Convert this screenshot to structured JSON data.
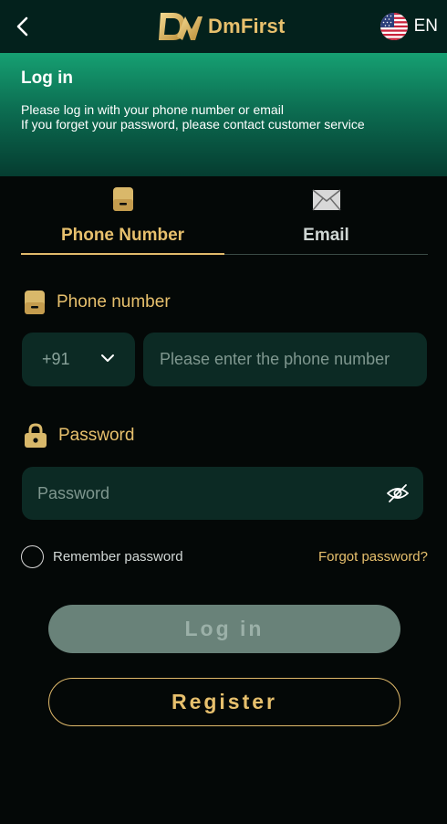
{
  "header": {
    "brand_name": "DmFirst",
    "language": "EN"
  },
  "banner": {
    "title": "Log in",
    "line1": "Please log in with your phone number or email",
    "line2": "If you forget your password, please contact customer service"
  },
  "tabs": [
    {
      "label": "Phone Number",
      "icon": "phone-icon",
      "active": true
    },
    {
      "label": "Email",
      "icon": "envelope-icon",
      "active": false
    }
  ],
  "phone_field": {
    "label": "Phone number",
    "country_code": "+91",
    "placeholder": "Please enter the phone number"
  },
  "password_field": {
    "label": "Password",
    "placeholder": "Password"
  },
  "remember": {
    "label": "Remember password"
  },
  "forgot": {
    "label": "Forgot password?"
  },
  "buttons": {
    "login": "Log in",
    "register": "Register"
  },
  "colors": {
    "gold": "#e7c06d",
    "background": "#040807",
    "input_bg": "#0c2a24",
    "banner_top": "#16a072"
  }
}
